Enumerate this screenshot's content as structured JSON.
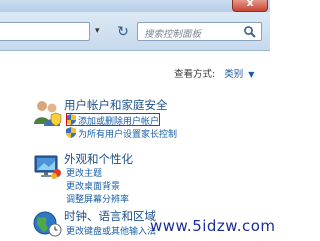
{
  "window": {
    "close_glyph": "x"
  },
  "toolbar": {
    "dropdown_glyph": "▾",
    "refresh_glyph": "↻",
    "search_placeholder": "搜索控制面板"
  },
  "view": {
    "label": "查看方式:",
    "value": "类别",
    "caret": "▼"
  },
  "sections": {
    "user_accounts": {
      "title": "用户帐户和家庭安全",
      "links": [
        "添加或删除用户帐户",
        "为所有用户设置家长控制"
      ]
    },
    "appearance": {
      "title": "外观和个性化",
      "links": [
        "更改主题",
        "更改桌面背景",
        "调整屏幕分辨率"
      ]
    },
    "clock_language": {
      "title": "时钟、语言和区域",
      "links": [
        "更改键盘或其他输入法"
      ]
    }
  },
  "watermark": {
    "text": "www.5idzw.com"
  },
  "colors": {
    "link": "#1a5fa8",
    "title": "#1e4f8a",
    "highlight": "#d80f0f"
  }
}
